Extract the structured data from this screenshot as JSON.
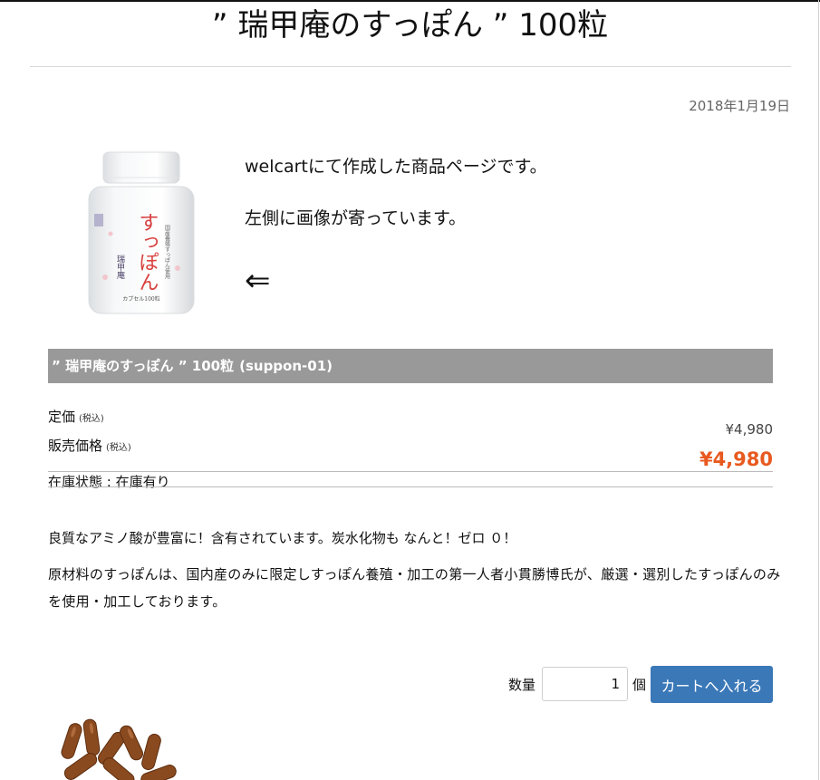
{
  "page": {
    "title": "” 瑞甲庵のすっぽん ” 100粒",
    "date": "2018年1月19日"
  },
  "intro": {
    "line1": "welcartにて作成した商品ページです。",
    "line2": "左側に画像が寄っています。",
    "arrow": "⇐"
  },
  "product_image": {
    "bottle_text": "すっぽん",
    "brand_text": "瑞甲庵",
    "side_text": "国産養殖すっぽん使用",
    "capsule_text": "カプセル100粒"
  },
  "item": {
    "name": "” 瑞甲庵のすっぽん ” 100粒",
    "code": "(suppon-01)",
    "list_price_label": "定価",
    "list_price_note": "(税込)",
    "sale_price_label": "販売価格",
    "sale_price_note": "(税込)",
    "list_price": "¥4,980",
    "sale_price": "¥4,980",
    "stock_label": "在庫状態 : 在庫有り"
  },
  "description": {
    "line1": "良質なアミノ酸が豊富に！含有されています。炭水化物も なんと！ゼロ ０！",
    "line2": "原材料のすっぽんは、国内産のみに限定しすっぽん養殖・加工の第一人者小貫勝博氏が、厳選・選別したすっぽんのみを使用・加工しております。"
  },
  "cart": {
    "quantity_label": "数量",
    "quantity_value": "1",
    "unit_label": "個",
    "button_label": "カートへ入れる"
  },
  "colors": {
    "item_bar": "#999999",
    "sale_price": "#e8591f",
    "cart_button": "#3a78b8"
  }
}
